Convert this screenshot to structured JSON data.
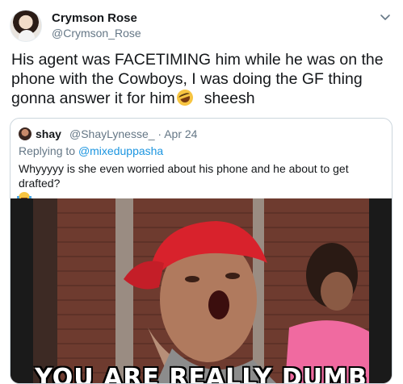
{
  "author": {
    "display_name": "Crymson Rose",
    "handle": "@Crymson_Rose",
    "avatar_icon": "profile-photo"
  },
  "menu_icon": "chevron-down-icon",
  "tweet": {
    "text_before_emoji": "His agent was FACETIMING him while he was on the phone with the Cowboys, I was doing the GF thing gonna answer it for him",
    "emoji": "rolling-on-floor-laughing-emoji",
    "text_after_emoji": "sheesh"
  },
  "quoted_tweet": {
    "display_name": "shay",
    "handle_and_date": "@ShayLynesse_ · Apr 24",
    "replying_prefix": "Replying to ",
    "replying_to": "@mixeduppasha",
    "text": "Whyyyyy is she even worried about his phone and he about to get drafted?",
    "emoji": "face-with-tears-of-joy-emoji",
    "media": {
      "caption": "YOU ARE REALLY DUMB"
    }
  },
  "colors": {
    "text": "#14171a",
    "secondary": "#657786",
    "link": "#1b95e0",
    "border": "#ccd6dd",
    "bandana": "#d8222c"
  }
}
